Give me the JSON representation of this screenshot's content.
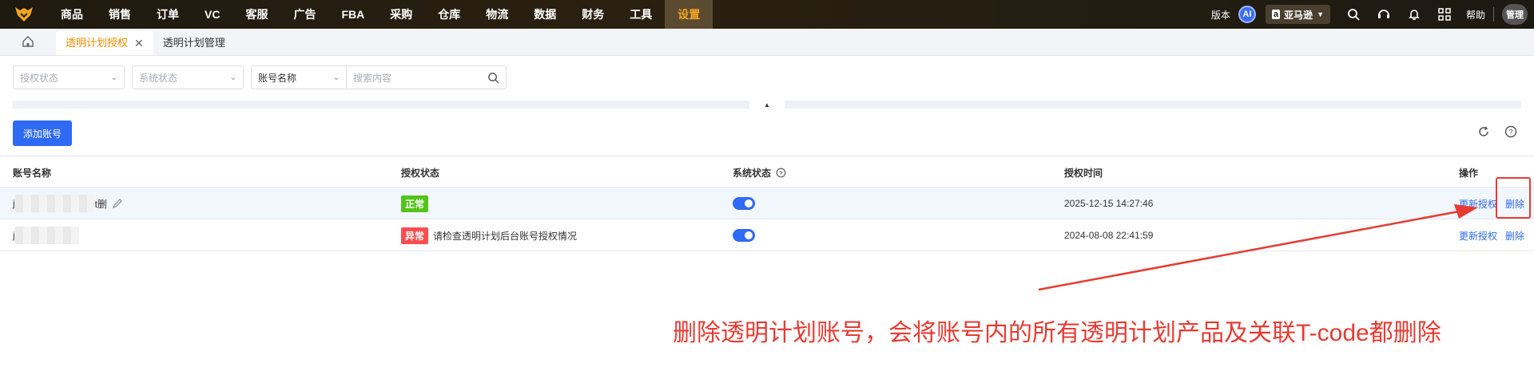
{
  "nav": {
    "items": [
      "商品",
      "销售",
      "订单",
      "VC",
      "客服",
      "广告",
      "FBA",
      "采购",
      "仓库",
      "物流",
      "数据",
      "财务",
      "工具",
      "设置"
    ],
    "active_index": 13,
    "version_label": "版本",
    "ai_label": "AI",
    "marketplace": "亚马逊",
    "help_label": "帮助",
    "user_label": "管理",
    "accent_color": "#f5a623"
  },
  "tabs": {
    "active": "透明计划授权",
    "second": "透明计划管理"
  },
  "filters": {
    "auth_status_placeholder": "授权状态",
    "system_status_placeholder": "系统状态",
    "field_select": "账号名称",
    "search_placeholder": "搜索内容"
  },
  "toolbar": {
    "add_label": "添加账号"
  },
  "table": {
    "headers": {
      "account": "账号名称",
      "auth_status": "授权状态",
      "system_status": "系统状态",
      "auth_time": "授权时间",
      "actions": "操作"
    },
    "rows": [
      {
        "account_prefix": "j",
        "account_suffix": "t删",
        "status": "正常",
        "status_note": "",
        "system_on": true,
        "time": "2025-12-15 14:27:46",
        "update_label": "更新授权",
        "delete_label": "删除"
      },
      {
        "account_prefix": "j",
        "account_suffix": "",
        "status": "异常",
        "status_note": "请检查透明计划后台账号授权情况",
        "system_on": true,
        "time": "2024-08-08 22:41:59",
        "update_label": "更新授权",
        "delete_label": "删除"
      }
    ]
  },
  "annotation": {
    "text": "删除透明计划账号，会将账号内的所有透明计划产品及关联T-code都删除",
    "color": "#e63b33"
  }
}
